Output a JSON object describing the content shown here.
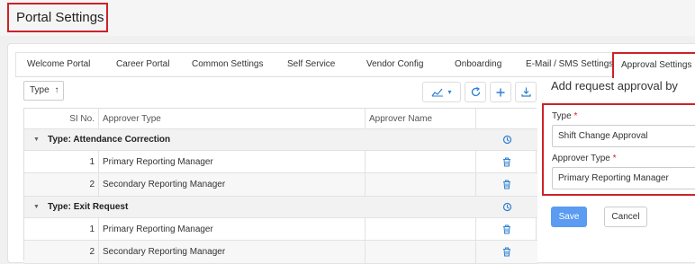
{
  "header": {
    "title": "Portal Settings"
  },
  "tabs": [
    {
      "label": "Welcome Portal",
      "active": false
    },
    {
      "label": "Career Portal",
      "active": false
    },
    {
      "label": "Common Settings",
      "active": false
    },
    {
      "label": "Self Service",
      "active": false
    },
    {
      "label": "Vendor Config",
      "active": false
    },
    {
      "label": "Onboarding",
      "active": false
    },
    {
      "label": "E-Mail / SMS Settings",
      "active": false
    },
    {
      "label": "Approval Settings",
      "active": true
    }
  ],
  "toolbar": {
    "group_chip": "Type",
    "group_chip_icon": "sort-up-arrow-icon"
  },
  "grid": {
    "columns": [
      "SI No.",
      "Approver Type",
      "Approver Name"
    ],
    "groups": [
      {
        "label": "Type: Attendance Correction",
        "rows": [
          {
            "si": "1",
            "approver_type": "Primary Reporting Manager",
            "approver_name": ""
          },
          {
            "si": "2",
            "approver_type": "Secondary Reporting Manager",
            "approver_name": ""
          }
        ]
      },
      {
        "label": "Type: Exit Request",
        "rows": [
          {
            "si": "1",
            "approver_type": "Primary Reporting Manager",
            "approver_name": ""
          },
          {
            "si": "2",
            "approver_type": "Secondary Reporting Manager",
            "approver_name": ""
          }
        ]
      }
    ]
  },
  "form": {
    "title": "Add request approval by",
    "type_label": "Type",
    "type_value": "Shift Change Approval",
    "approver_type_label": "Approver Type",
    "approver_type_value": "Primary Reporting Manager",
    "required_mark": "*",
    "save_label": "Save",
    "cancel_label": "Cancel"
  },
  "colors": {
    "accent": "#2d7fd0",
    "highlight_border": "#cc2229",
    "save_button": "#5b9bf1"
  }
}
